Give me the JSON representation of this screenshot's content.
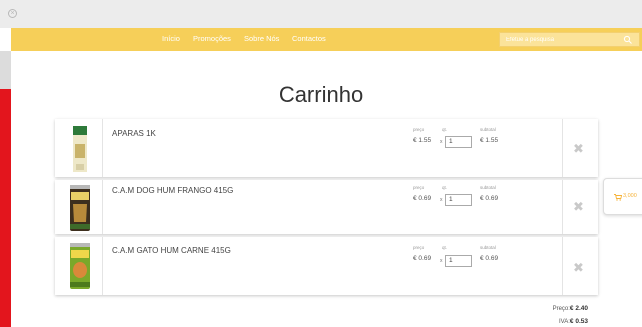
{
  "nav": {
    "items": [
      "Início",
      "Promoções",
      "Sobre Nós",
      "Contactos"
    ]
  },
  "search": {
    "placeholder": "Efetue a pesquisa"
  },
  "page": {
    "title": "Carrinho"
  },
  "columns": {
    "price": "preço",
    "qty": "qt.",
    "subtotal": "subtotal"
  },
  "items": [
    {
      "name": "APARAS 1K",
      "price": "€ 1.55",
      "qty_prefix": "x",
      "qty": "1",
      "subtotal": "€ 1.55"
    },
    {
      "name": "C.A.M DOG HUM FRANGO 415G",
      "price": "€ 0.69",
      "qty_prefix": "x",
      "qty": "1",
      "subtotal": "€ 0.69"
    },
    {
      "name": "C.A.M GATO HUM CARNE 415G",
      "price": "€ 0.69",
      "qty_prefix": "x",
      "qty": "1",
      "subtotal": "€ 0.69"
    }
  ],
  "minicart": {
    "total": "3,000"
  },
  "totals": {
    "price_label": "Preço:",
    "price_value": "€ 2.40",
    "vat_label": "IVA:",
    "vat_value": "€ 0.53"
  },
  "colors": {
    "navbar": "#f6cf59",
    "accent_red": "#e3151d",
    "minicart_total": "#f6b33a"
  }
}
